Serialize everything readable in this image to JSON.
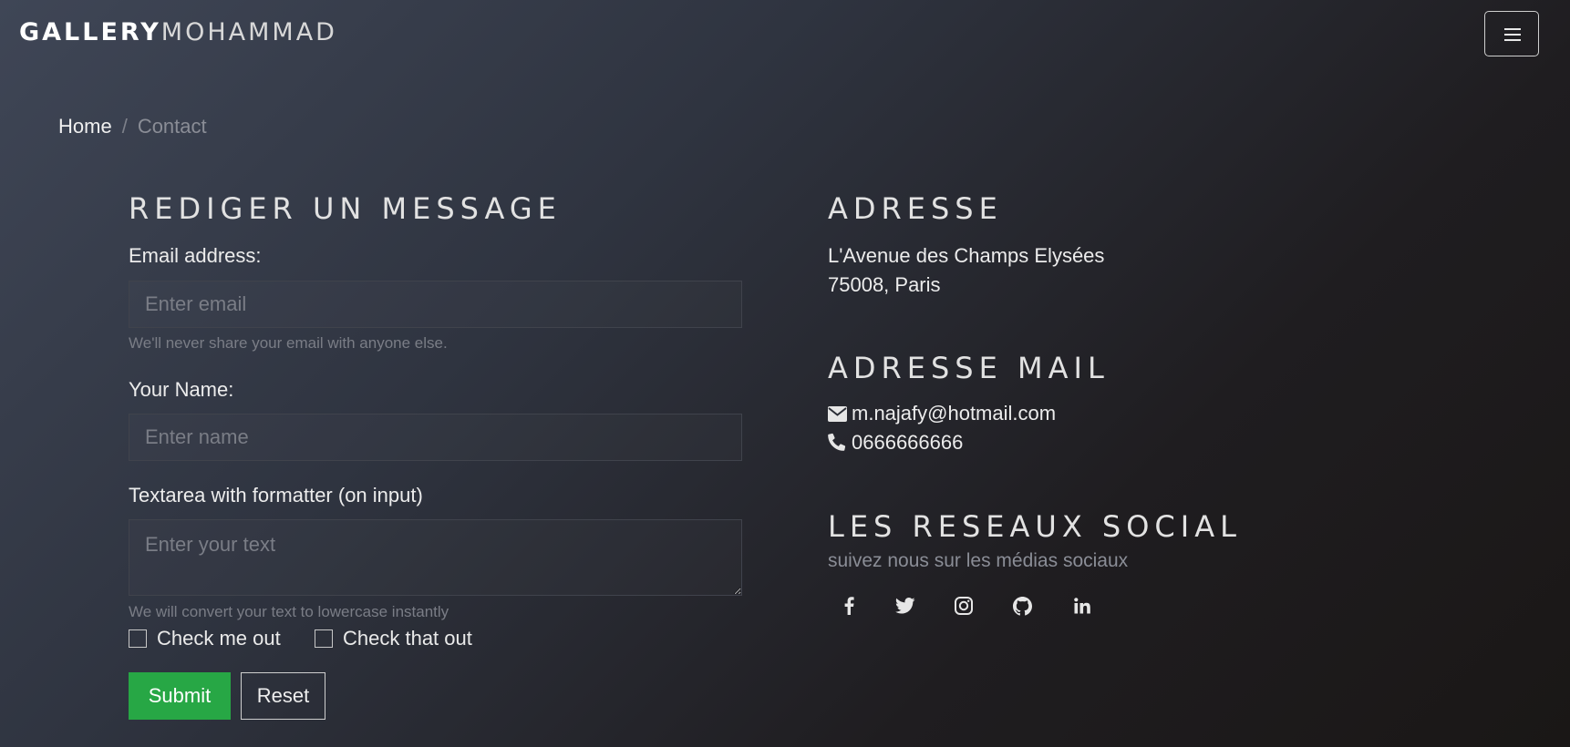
{
  "nav": {
    "brand_bold": "GALLERY",
    "brand_light": "MOHAMMAD"
  },
  "breadcrumb": {
    "home": "Home",
    "separator": "/",
    "current": "Contact"
  },
  "form": {
    "title": "REDIGER UN MESSAGE",
    "email_label": "Email address:",
    "email_placeholder": "Enter email",
    "email_help": "We'll never share your email with anyone else.",
    "name_label": "Your Name:",
    "name_placeholder": "Enter name",
    "text_label": "Textarea with formatter (on input)",
    "text_placeholder": "Enter your text",
    "text_help": "We will convert your text to lowercase instantly",
    "check1": "Check me out",
    "check2": "Check that out",
    "submit": "Submit",
    "reset": "Reset"
  },
  "info": {
    "address_title": "ADRESSE",
    "address_line1": "L'Avenue des Champs Elysées",
    "address_line2": "75008, Paris",
    "mail_title": "ADRESSE MAIL",
    "email": "m.najafy@hotmail.com",
    "phone": "0666666666",
    "social_title": "LES RESEAUX SOCIAL",
    "social_subtitle": "suivez nous sur les médias sociaux",
    "social_icons": [
      "facebook-icon",
      "twitter-icon",
      "instagram-icon",
      "github-icon",
      "linkedin-icon"
    ]
  },
  "colors": {
    "submit_green": "#27a745"
  }
}
